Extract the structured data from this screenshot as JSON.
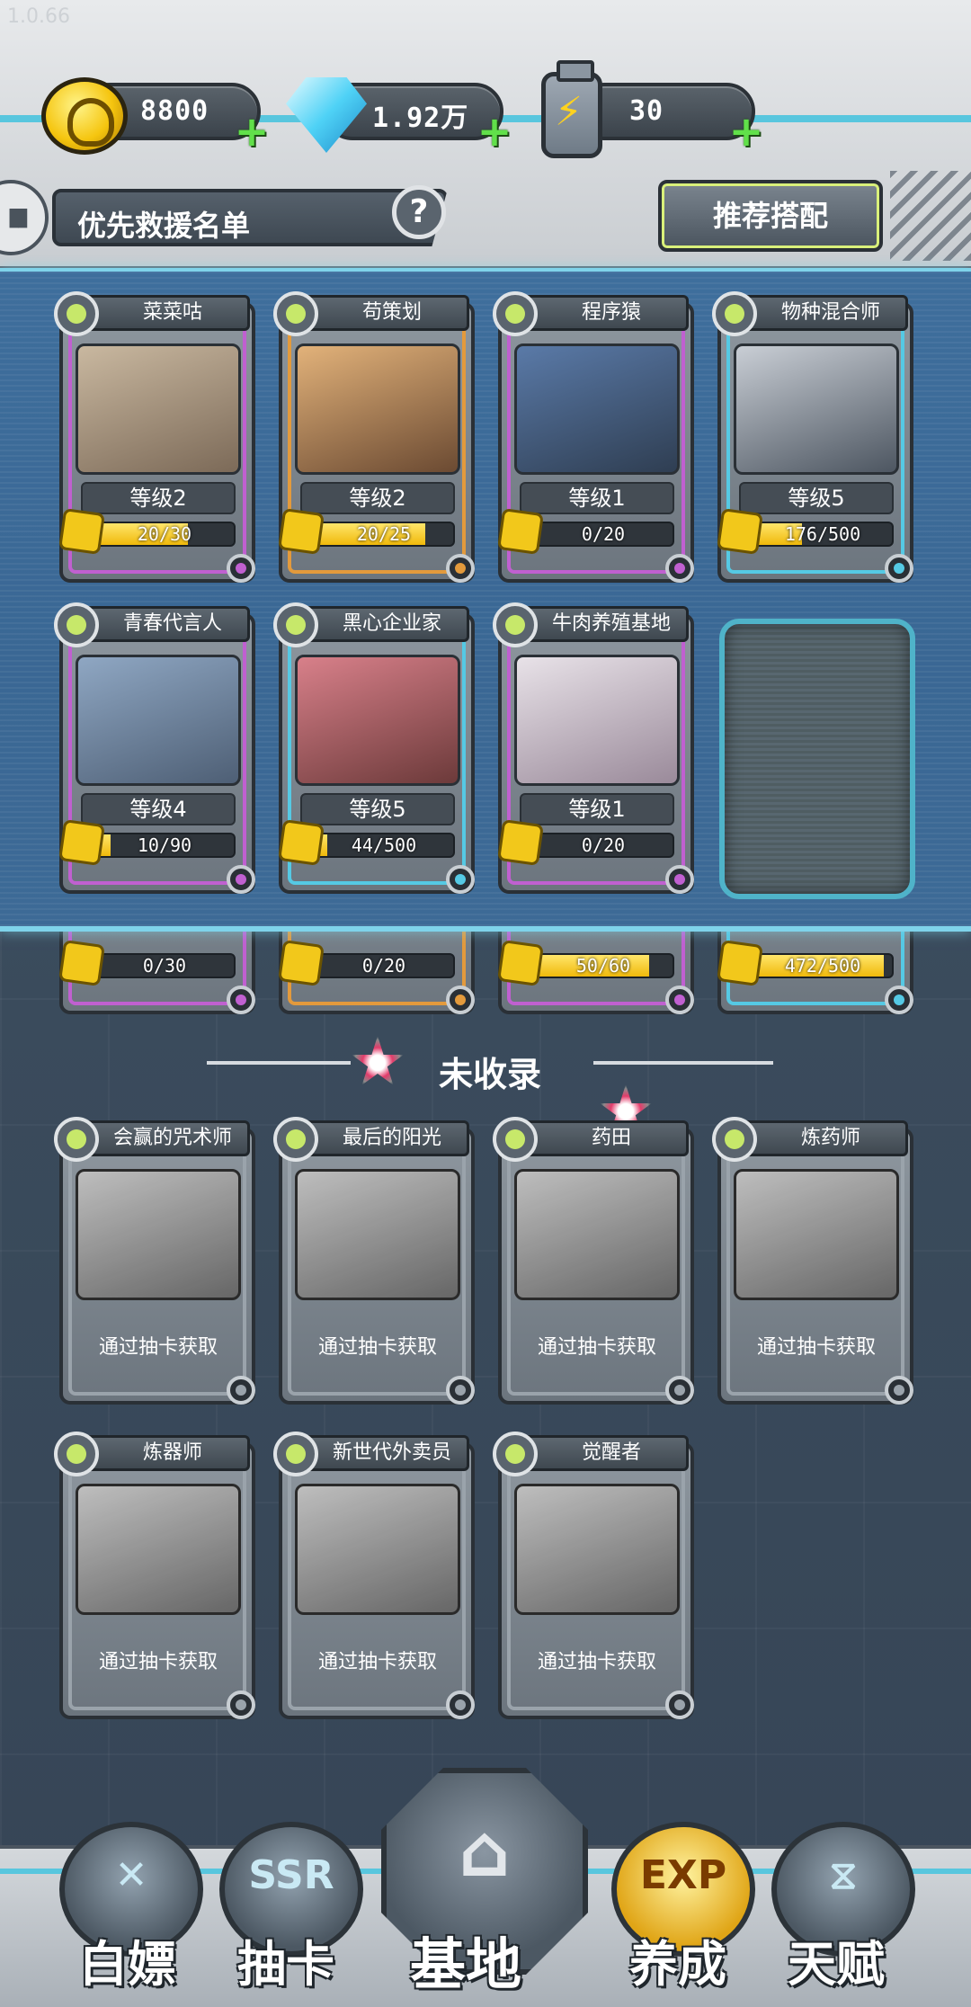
{
  "version": "1.0.66",
  "resources": {
    "coins": "8800",
    "gems": "1.92万",
    "energy": "30",
    "plus": "+"
  },
  "header": {
    "title": "优先救援名单",
    "help": "?",
    "recommend_button": "推荐搭配"
  },
  "team": [
    {
      "name": "菜菜咕",
      "level": "等级2",
      "progress": "20/30",
      "fill": 0.67,
      "rim": "#c060d0",
      "art": [
        "#c9b8a0",
        "#7c6a58"
      ]
    },
    {
      "name": "苟策划",
      "level": "等级2",
      "progress": "20/25",
      "fill": 0.8,
      "rim": "#e39a3c",
      "art": [
        "#e2b27a",
        "#6b4a32"
      ]
    },
    {
      "name": "程序猿",
      "level": "等级1",
      "progress": "0/20",
      "fill": 0,
      "rim": "#c060d0",
      "art": [
        "#5a7aa8",
        "#2f3e52"
      ]
    },
    {
      "name": "物种混合师",
      "level": "等级5",
      "progress": "176/500",
      "fill": 0.35,
      "rim": "#55c9e4",
      "art": [
        "#c9ced5",
        "#4d5661"
      ]
    },
    {
      "name": "青春代言人",
      "level": "等级4",
      "progress": "10/90",
      "fill": 0.11,
      "rim": "#c060d0",
      "art": [
        "#8fa7c3",
        "#4e5f75"
      ]
    },
    {
      "name": "黑心企业家",
      "level": "等级5",
      "progress": "44/500",
      "fill": 0.09,
      "rim": "#55c9e4",
      "art": [
        "#d8808a",
        "#6c3a3a"
      ]
    },
    {
      "name": "牛肉养殖基地",
      "level": "等级1",
      "progress": "0/20",
      "fill": 0,
      "rim": "#c060d0",
      "art": [
        "#e8e2e8",
        "#9a8a9a"
      ]
    }
  ],
  "team_peek": [
    {
      "progress": "0/30",
      "fill": 0,
      "rim": "#c060d0"
    },
    {
      "progress": "0/20",
      "fill": 0,
      "rim": "#e39a3c"
    },
    {
      "progress": "50/60",
      "fill": 0.83,
      "rim": "#c060d0"
    },
    {
      "progress": "472/500",
      "fill": 0.94,
      "rim": "#55c9e4"
    }
  ],
  "uncollected": {
    "title": "未收录",
    "acquire_text": "通过抽卡获取",
    "cards": [
      {
        "name": "会赢的咒术师"
      },
      {
        "name": "最后的阳光"
      },
      {
        "name": "药田"
      },
      {
        "name": "炼药师"
      },
      {
        "name": "炼器师"
      },
      {
        "name": "新世代外卖员"
      },
      {
        "name": "觉醒者"
      }
    ]
  },
  "nav": [
    {
      "label": "白嫖",
      "glyph": "✕",
      "icon": "freebie-icon"
    },
    {
      "label": "抽卡",
      "glyph": "SSR",
      "icon": "gacha-icon"
    },
    {
      "label": "基地",
      "glyph": "⌂",
      "icon": "base-icon",
      "active": true
    },
    {
      "label": "养成",
      "glyph": "EXP",
      "icon": "exp-icon"
    },
    {
      "label": "天赋",
      "glyph": "⧖",
      "icon": "dna-icon"
    }
  ]
}
